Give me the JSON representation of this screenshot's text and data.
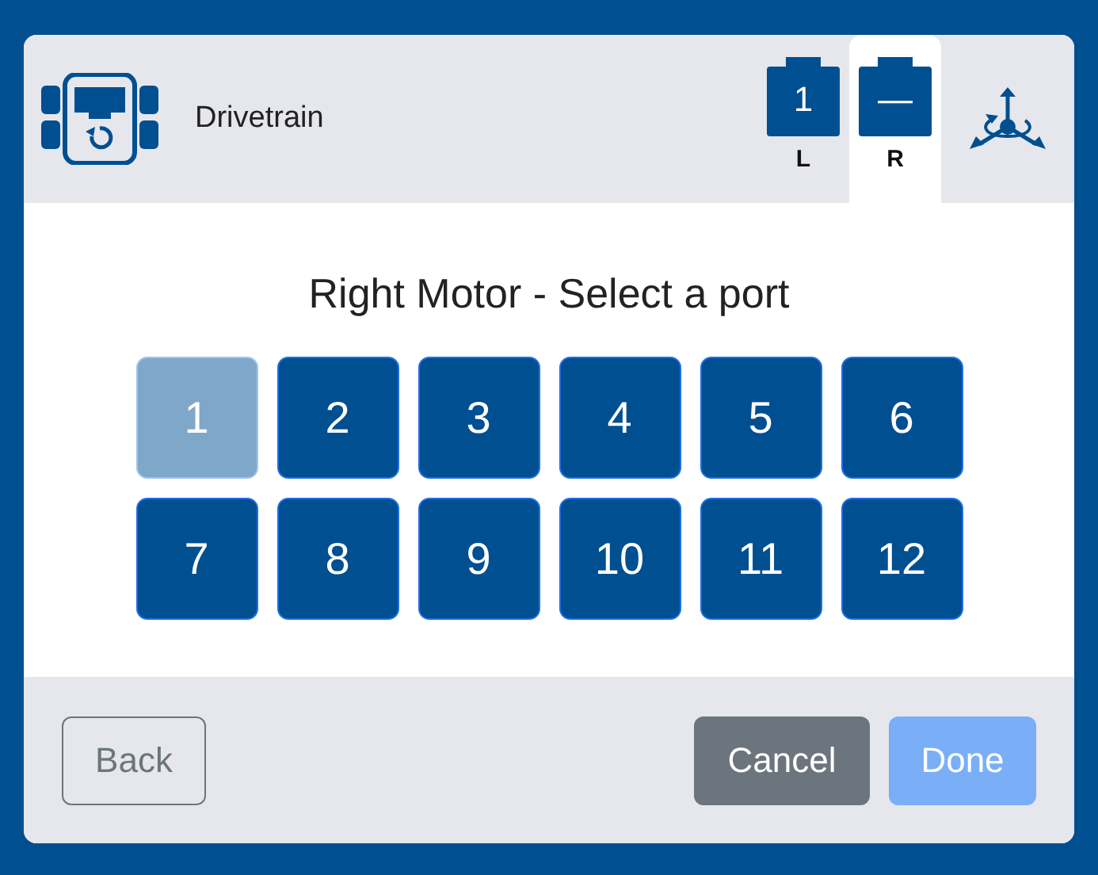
{
  "header": {
    "title": "Drivetrain",
    "motors": [
      {
        "number": "1",
        "side": "L",
        "selected": false
      },
      {
        "number": "—",
        "side": "R",
        "selected": true
      }
    ]
  },
  "heading": "Right Motor - Select a port",
  "ports": [
    {
      "label": "1",
      "disabled": true
    },
    {
      "label": "2",
      "disabled": false
    },
    {
      "label": "3",
      "disabled": false
    },
    {
      "label": "4",
      "disabled": false
    },
    {
      "label": "5",
      "disabled": false
    },
    {
      "label": "6",
      "disabled": false
    },
    {
      "label": "7",
      "disabled": false
    },
    {
      "label": "8",
      "disabled": false
    },
    {
      "label": "9",
      "disabled": false
    },
    {
      "label": "10",
      "disabled": false
    },
    {
      "label": "11",
      "disabled": false
    },
    {
      "label": "12",
      "disabled": false
    }
  ],
  "footer": {
    "back": {
      "label": "Back",
      "disabled": false
    },
    "cancel": {
      "label": "Cancel",
      "disabled": false
    },
    "done": {
      "label": "Done",
      "disabled": true
    }
  }
}
